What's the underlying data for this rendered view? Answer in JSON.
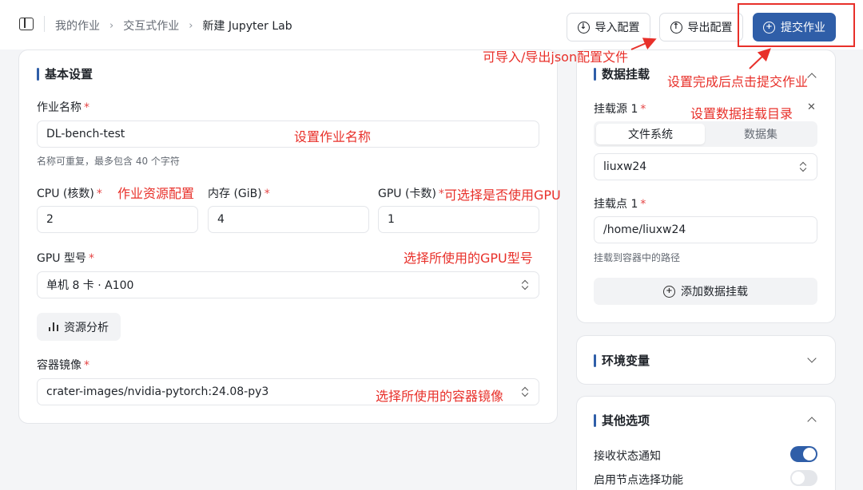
{
  "breadcrumb": {
    "items": [
      "我的作业",
      "交互式作业",
      "新建 Jupyter Lab"
    ],
    "separator": "›"
  },
  "toolbar": {
    "import_label": "导入配置",
    "export_label": "导出配置",
    "submit_label": "提交作业"
  },
  "basic": {
    "title": "基本设置",
    "job_name_label": "作业名称",
    "job_name_value": "DL-bench-test",
    "job_name_hint": "名称可重复，最多包含 40 个字符",
    "cpu_label": "CPU (核数)",
    "cpu_value": "2",
    "mem_label": "内存 (GiB)",
    "mem_value": "4",
    "gpu_label": "GPU (卡数)",
    "gpu_value": "1",
    "gpu_model_label": "GPU 型号",
    "gpu_model_value": "单机 8 卡 · A100",
    "analysis_label": "资源分析",
    "image_label": "容器镜像",
    "image_value": "crater-images/nvidia-pytorch:24.08-py3",
    "required_mark": "*"
  },
  "mount": {
    "title": "数据挂载",
    "source_label": "挂载源 1",
    "tab_fs": "文件系统",
    "tab_dataset": "数据集",
    "source_value": "liuxw24",
    "point_label": "挂载点 1",
    "point_value": "/home/liuxw24",
    "point_hint": "挂载到容器中的路径",
    "add_label": "添加数据挂载",
    "close_glyph": "✕"
  },
  "env": {
    "title": "环境变量"
  },
  "other": {
    "title": "其他选项",
    "notify_label": "接收状态通知",
    "notify_on": true,
    "node_label": "启用节点选择功能",
    "node_on": false
  },
  "annotations": {
    "import_export": "可导入/导出json配置文件",
    "submit": "设置完成后点击提交作业",
    "mount": "设置数据挂载目录",
    "name": "设置作业名称",
    "resource": "作业资源配置",
    "gpu": "可选择是否使用GPU",
    "gpu_model": "选择所使用的GPU型号",
    "image": "选择所使用的容器镜像"
  },
  "colors": {
    "accent": "#2f5ea8",
    "annotation": "#e8302a",
    "required": "#e54545"
  }
}
